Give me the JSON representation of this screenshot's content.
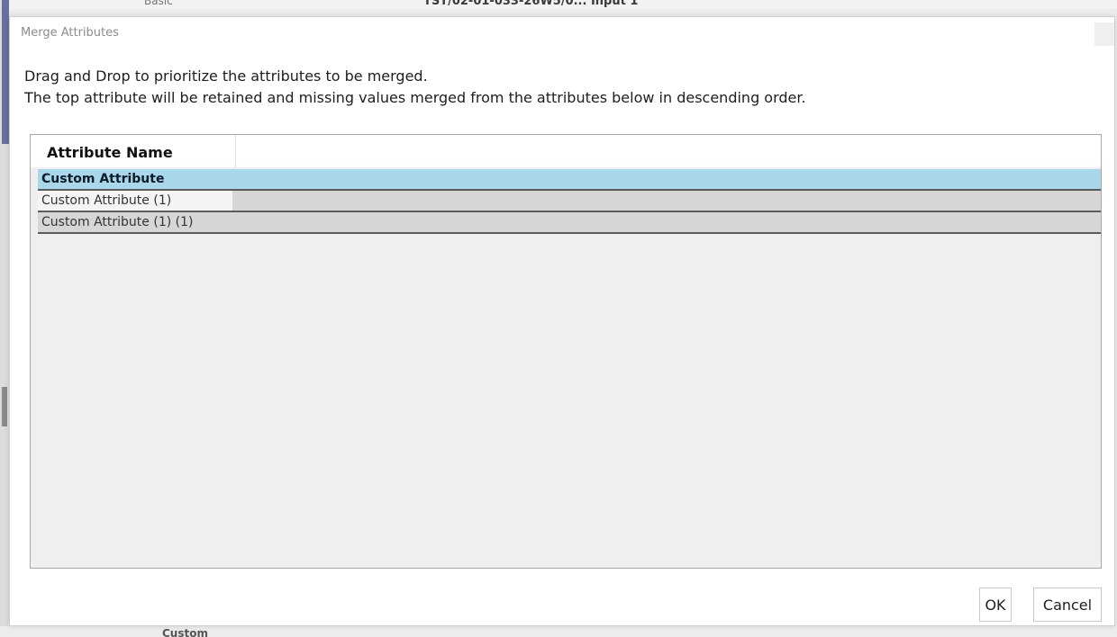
{
  "background": {
    "top_text": "TST/02-01-033-26W5/0... Input 1",
    "top_node": "Basic",
    "bottom_text": "Custom"
  },
  "dialog": {
    "title": "Merge Attributes",
    "instruction_line1": "Drag and Drop to prioritize the attributes to be merged.",
    "instruction_line2": "The top attribute will be retained and missing values merged from the attributes below in descending order.",
    "grid": {
      "column_header": "Attribute Name",
      "rows": [
        {
          "name": "Custom Attribute",
          "selected": true
        },
        {
          "name": "Custom Attribute (1)",
          "selected": false
        },
        {
          "name": "Custom Attribute (1) (1)",
          "selected": false
        }
      ]
    },
    "buttons": {
      "ok": "OK",
      "cancel": "Cancel"
    }
  },
  "colors": {
    "selected_row": "#a8d8ea",
    "unselected_row": "#d6d6d6",
    "grid_background": "#efefef"
  }
}
